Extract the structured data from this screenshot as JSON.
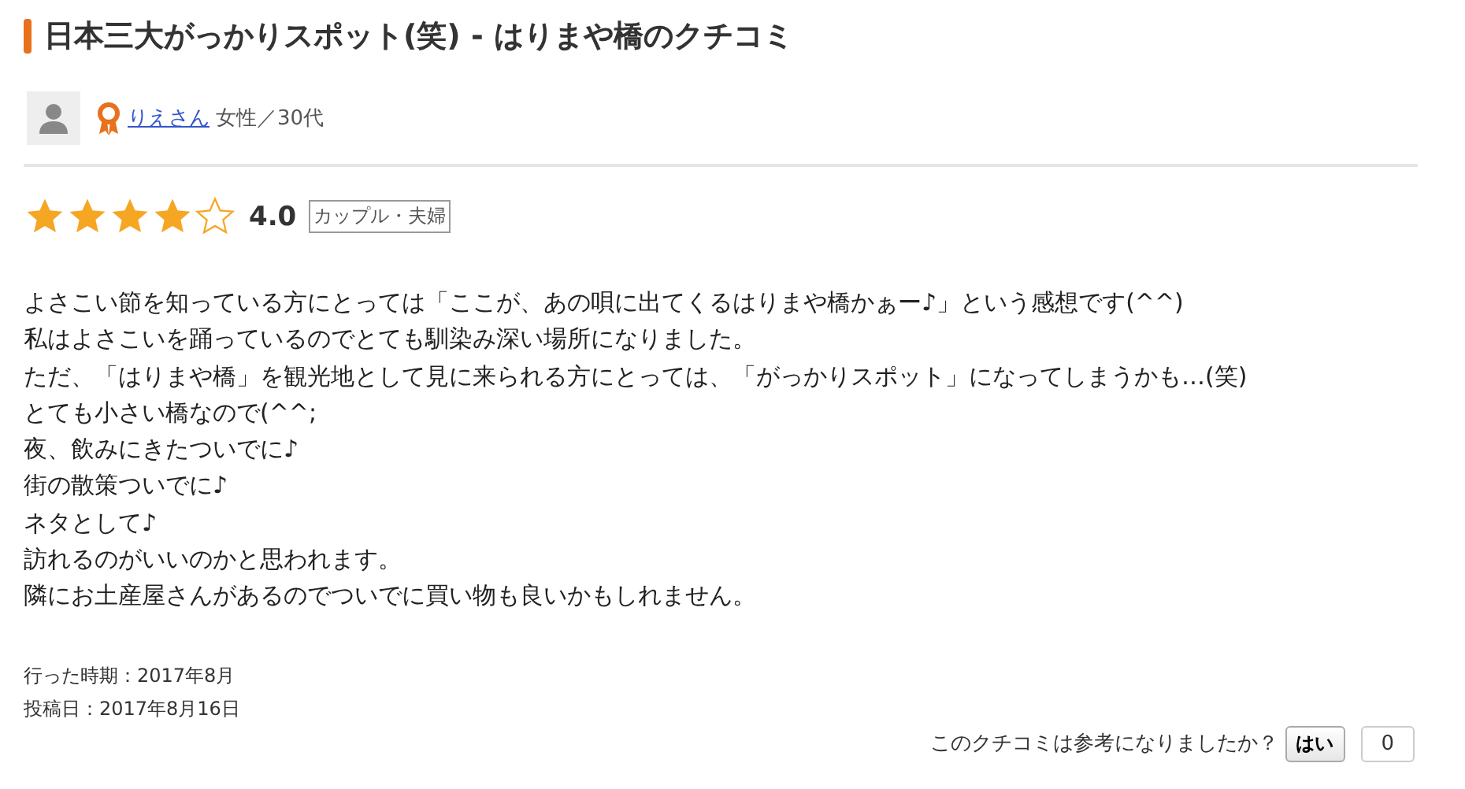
{
  "title": "日本三大がっかりスポット(笑) - はりまや橋のクチコミ",
  "reviewer": {
    "name": "りえさん",
    "profile": "女性／30代"
  },
  "rating": {
    "stars": 4,
    "score": "4.0",
    "tag": "カップル・夫婦"
  },
  "body": [
    "よさこい節を知っている方にとっては「ここが、あの唄に出てくるはりまや橋かぁー♪」という感想です(^^)",
    "私はよさこいを踊っているのでとても馴染み深い場所になりました。",
    "ただ、「はりまや橋」を観光地として見に来られる方にとっては、「がっかりスポット」になってしまうかも…(笑)",
    "とても小さい橋なので(^^;",
    "夜、飲みにきたついでに♪",
    "街の散策ついでに♪",
    "ネタとして♪",
    "訪れるのがいいのかと思われます。",
    "隣にお土産屋さんがあるのでついでに買い物も良いかもしれません。"
  ],
  "visit_date": "行った時期：2017年8月",
  "post_date": "投稿日：2017年8月16日",
  "helpful": {
    "question": "このクチコミは参考になりましたか？",
    "button": "はい",
    "count": "0"
  }
}
